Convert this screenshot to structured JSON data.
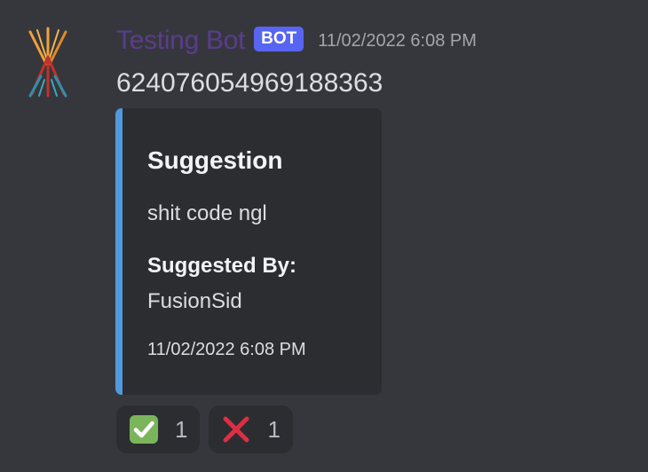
{
  "message": {
    "author": {
      "username": "Testing Bot",
      "tag": "BOT",
      "avatar_icon": "bot-logo-icon"
    },
    "timestamp": "11/02/2022 6:08 PM",
    "content": "624076054969188363",
    "embed": {
      "accent_color": "#5099dc",
      "title": "Suggestion",
      "description": "shit code ngl",
      "fields": [
        {
          "name": "Suggested By:",
          "value": "FusionSid"
        }
      ],
      "footer": "11/02/2022 6:08 PM"
    },
    "reactions": [
      {
        "emoji": "white-check-mark-icon",
        "count": "1"
      },
      {
        "emoji": "x-mark-icon",
        "count": "1"
      }
    ]
  }
}
